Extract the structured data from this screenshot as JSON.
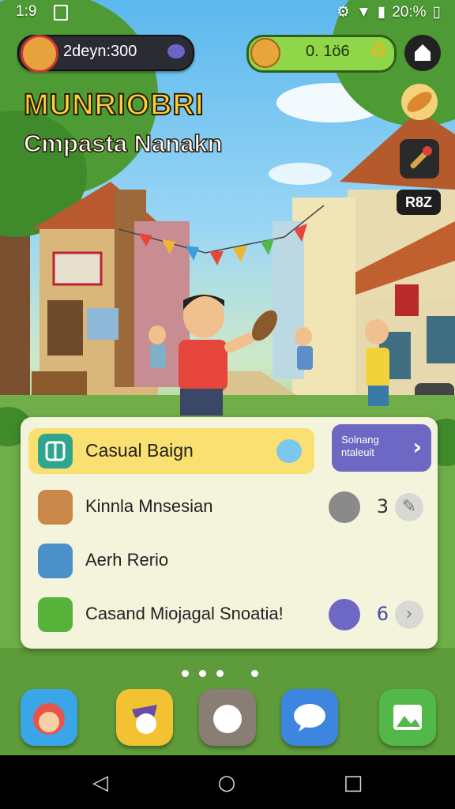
{
  "status_bar": {
    "time": "1:9",
    "battery": "20:%"
  },
  "player": {
    "name": "2deyn:300"
  },
  "currency": {
    "value": "0. 1ö6"
  },
  "side_panel": {
    "code": "R8Z"
  },
  "titles": {
    "title": "MUNRIOBRI",
    "subtitle": "Cmpasta Nanakn"
  },
  "quest_panel": {
    "highlight": {
      "label": "Casual Baign"
    },
    "next_button": {
      "line1": "Solnang",
      "line2": "ntaleuit",
      "arrow": "›"
    },
    "rows": [
      {
        "label": "Kinnla Mnsesian",
        "count": "3"
      },
      {
        "label": "Aerh Rerio"
      },
      {
        "label": "Casand Miojagal Snoatia!",
        "count": "6"
      }
    ]
  },
  "page_indicator": {
    "pages": 4,
    "active": 0
  },
  "dock": {
    "apps": [
      {
        "name": "profile-app-icon",
        "color": "#3aa6e8"
      },
      {
        "name": "character-app-icon",
        "color": "#f2c233"
      },
      {
        "name": "pet-app-icon",
        "color": "#8a7d75"
      },
      {
        "name": "chat-app-icon",
        "color": "#3c86e0"
      },
      {
        "name": "gallery-app-icon",
        "color": "#52b84a"
      }
    ]
  },
  "nav": {
    "back": "◁",
    "home": "○",
    "recents": "□"
  },
  "colors": {
    "accent": "#6c68c4",
    "highlight": "#f9e070",
    "gold": "#f6d13b"
  }
}
